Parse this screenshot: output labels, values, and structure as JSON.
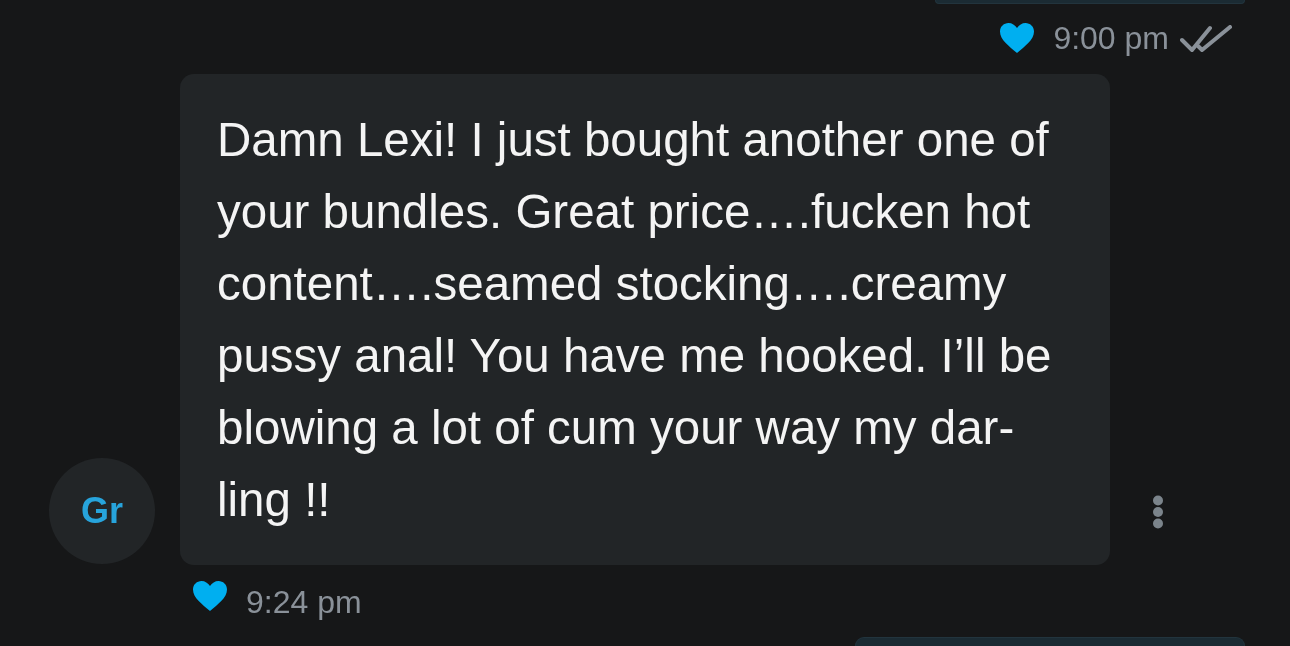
{
  "messages": [
    {
      "kind": "sent",
      "liked": true,
      "time": "9:00 pm",
      "read": true
    },
    {
      "kind": "received",
      "avatar": "Gr",
      "text": "Damn Lexi! I just bought another one of\nyour bundles. Great price….fucken hot\ncontent….seamed stocking….creamy\npussy anal! You have me hooked. I’ll be\nblowing a lot of cum your way my dar-\nling !!",
      "liked": true,
      "time": "9:24 pm"
    },
    {
      "kind": "sent"
    }
  ]
}
